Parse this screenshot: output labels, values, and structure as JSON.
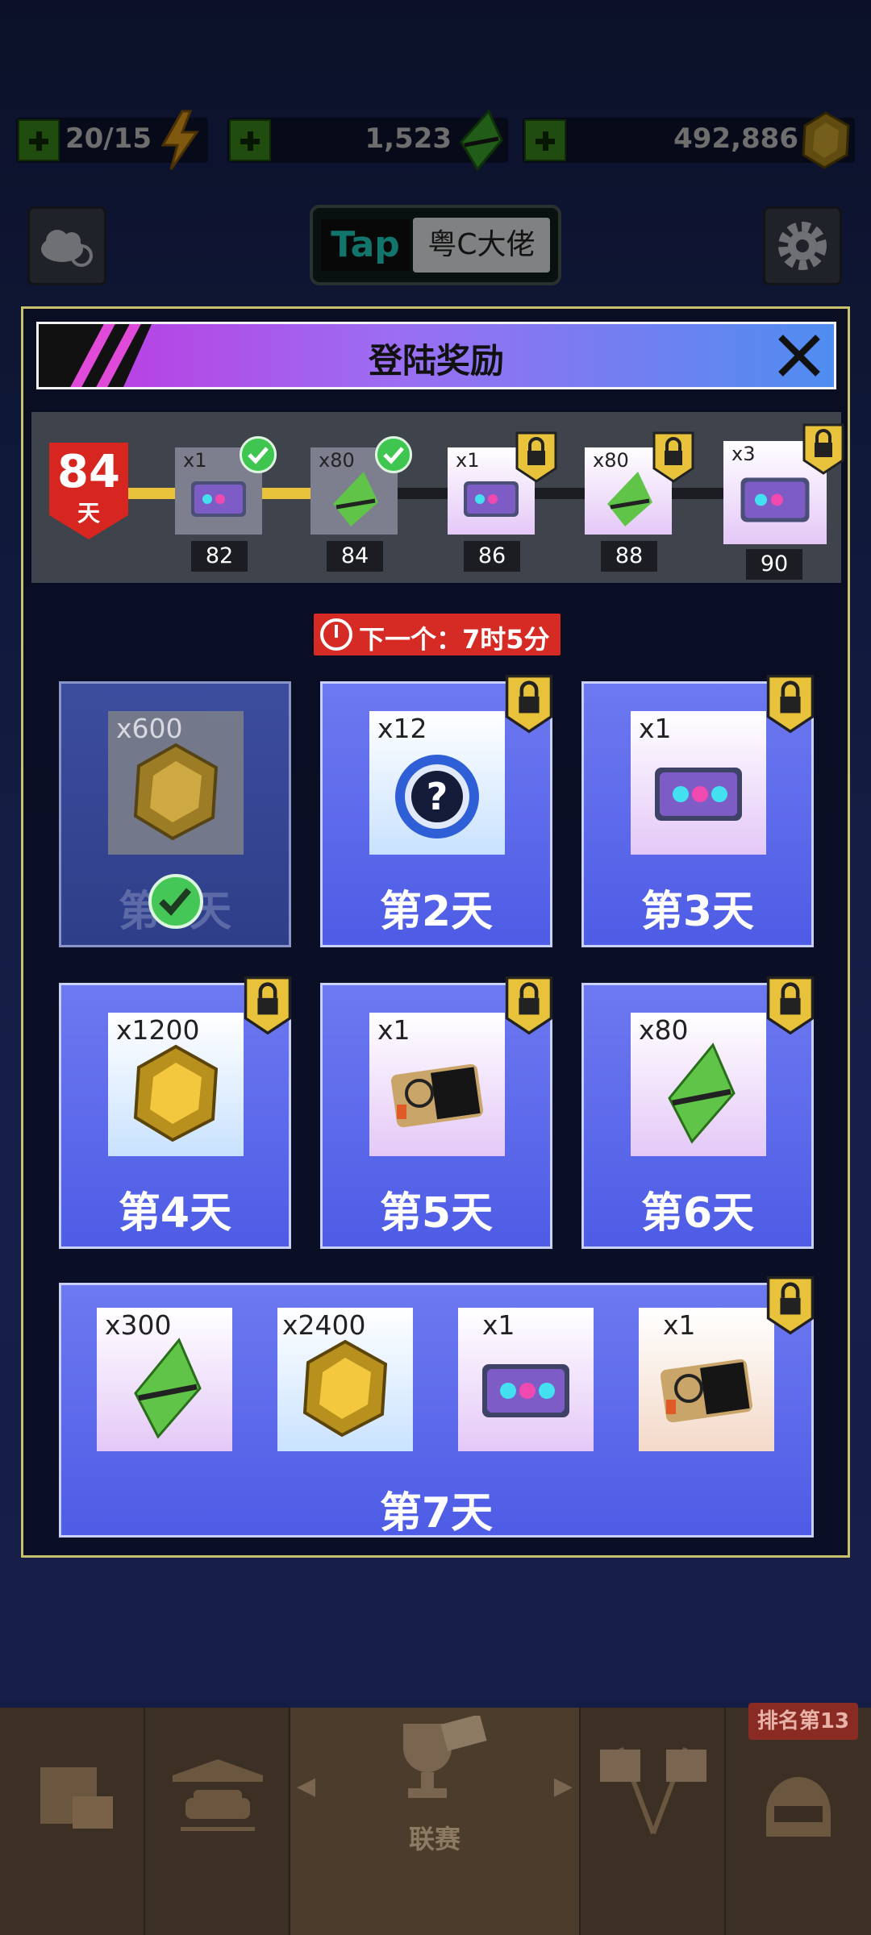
{
  "resources": {
    "energy": "20/15",
    "gems": "1,523",
    "coins": "492,886"
  },
  "header": {
    "plate_brand": "Tap",
    "plate_name": "粤C大佬"
  },
  "panel": {
    "title": "登陆奖励"
  },
  "progress": {
    "current_days": "84",
    "days_unit": "天",
    "milestones": [
      {
        "qty": "x1",
        "day": "82",
        "item": "ticket-card",
        "claimed": true
      },
      {
        "qty": "x80",
        "day": "84",
        "item": "green-gem",
        "claimed": true
      },
      {
        "qty": "x1",
        "day": "86",
        "item": "ticket-card",
        "claimed": false
      },
      {
        "qty": "x80",
        "day": "88",
        "item": "green-gem",
        "claimed": false
      },
      {
        "qty": "x3",
        "day": "90",
        "item": "ticket-card",
        "claimed": false
      }
    ]
  },
  "timer": {
    "text": "下一个：7时5分"
  },
  "days": [
    {
      "label": "第1天",
      "qty": "x600",
      "item": "gold-coin",
      "claimed": true
    },
    {
      "label": "第2天",
      "qty": "x12",
      "item": "mystery-box",
      "claimed": false
    },
    {
      "label": "第3天",
      "qty": "x1",
      "item": "ticket-card",
      "claimed": false
    },
    {
      "label": "第4天",
      "qty": "x1200",
      "item": "gold-coin",
      "claimed": false
    },
    {
      "label": "第5天",
      "qty": "x1",
      "item": "turbo-card",
      "claimed": false
    },
    {
      "label": "第6天",
      "qty": "x80",
      "item": "green-gem",
      "claimed": false
    }
  ],
  "day7": {
    "label": "第7天",
    "rewards": [
      {
        "qty": "x300",
        "item": "green-gem"
      },
      {
        "qty": "x2400",
        "item": "gold-coin"
      },
      {
        "qty": "x1",
        "item": "ticket-card"
      },
      {
        "qty": "x1",
        "item": "turbo-card"
      }
    ]
  },
  "nav": {
    "league_label": "联赛",
    "rank_badge": "排名第13"
  },
  "colors": {
    "accent_purple": "#c035e0",
    "accent_blue": "#4f8df0",
    "card_blue": "#5b68ea",
    "check_green": "#3ec651",
    "badge_red": "#d7261f",
    "lock_gold": "#e8c23a"
  }
}
